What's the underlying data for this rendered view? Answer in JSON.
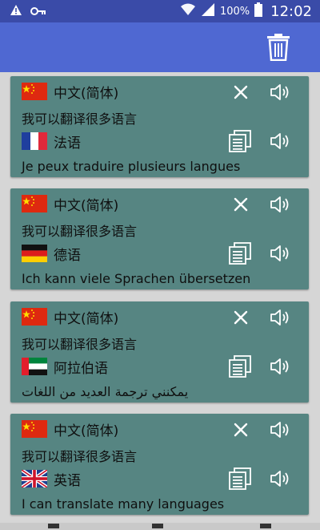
{
  "status_bar": {
    "battery_percent": "100%",
    "time": "12:02",
    "icons": [
      "warning-icon",
      "key-icon",
      "wifi-icon",
      "signal-icon",
      "battery-icon"
    ]
  },
  "app_bar": {
    "icons": [
      "trash-icon"
    ]
  },
  "cards": [
    {
      "source_lang": "中文(简体)",
      "source_text": "我可以翻译很多语言",
      "target_lang": "法语",
      "target_text": "Je peux traduire plusieurs langues",
      "target_flag": "france"
    },
    {
      "source_lang": "中文(简体)",
      "source_text": "我可以翻译很多语言",
      "target_lang": "德语",
      "target_text": "Ich kann viele Sprachen übersetzen",
      "target_flag": "germany"
    },
    {
      "source_lang": "中文(简体)",
      "source_text": "我可以翻译很多语言",
      "target_lang": "阿拉伯语",
      "target_text": "يمكنني ترجمة العديد من اللغات",
      "target_flag": "uae"
    },
    {
      "source_lang": "中文(简体)",
      "source_text": "我可以翻译很多语言",
      "target_lang": "英语",
      "target_text": "I can translate many languages",
      "target_flag": "uk"
    }
  ],
  "colors": {
    "status_bar": "#3a4ba8",
    "app_bar": "#4f68d2",
    "card": "#568582",
    "background": "#d6d6d6"
  }
}
